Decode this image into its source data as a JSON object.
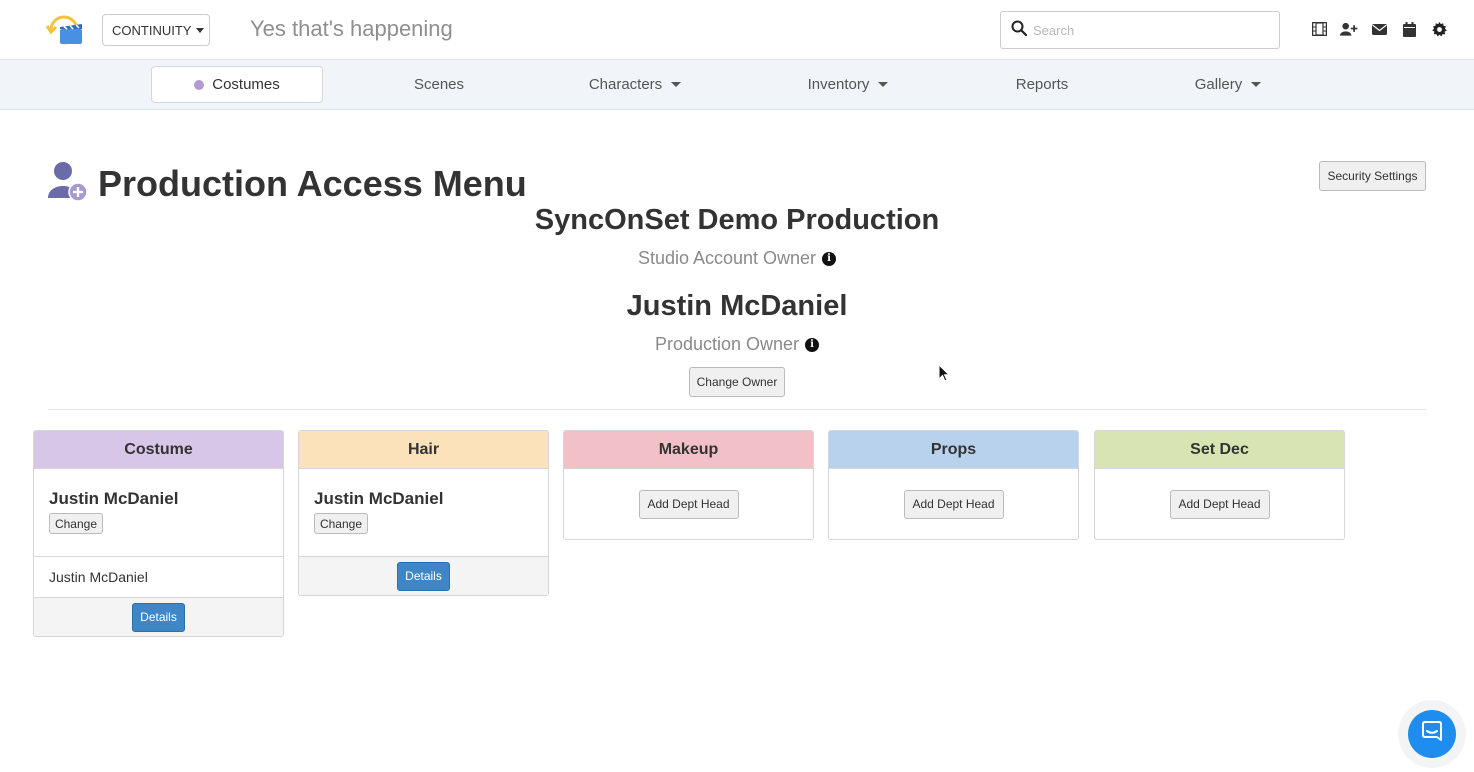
{
  "header": {
    "mode_label": "CONTINUITY",
    "production_tagline": "Yes that's happening",
    "search_placeholder": "Search",
    "icons": [
      "film-icon",
      "add-user-icon",
      "mail-icon",
      "calendar-icon",
      "gear-icon"
    ]
  },
  "nav": {
    "items": [
      {
        "label": "Costumes",
        "active": true
      },
      {
        "label": "Scenes"
      },
      {
        "label": "Characters",
        "dropdown": true
      },
      {
        "label": "Inventory",
        "dropdown": true
      },
      {
        "label": "Reports"
      },
      {
        "label": "Gallery",
        "dropdown": true
      }
    ]
  },
  "page": {
    "title": "Production Access Menu",
    "security_button": "Security Settings",
    "studio_name": "SyncOnSet Demo Production",
    "studio_role": "Studio Account Owner",
    "owner_name": "Justin McDaniel",
    "owner_role": "Production Owner",
    "change_owner_button": "Change Owner"
  },
  "departments": [
    {
      "name": "Costume",
      "color": "#d8c6e9",
      "head": "Justin McDaniel",
      "change_label": "Change",
      "members": [
        "Justin McDaniel"
      ],
      "details_label": "Details"
    },
    {
      "name": "Hair",
      "color": "#fbe2bb",
      "head": "Justin McDaniel",
      "change_label": "Change",
      "members": [],
      "details_label": "Details"
    },
    {
      "name": "Makeup",
      "color": "#f2c1c8",
      "add_label": "Add Dept Head"
    },
    {
      "name": "Props",
      "color": "#b8d2ee",
      "add_label": "Add Dept Head"
    },
    {
      "name": "Set Dec",
      "color": "#d8e4b2",
      "add_label": "Add Dept Head"
    }
  ]
}
